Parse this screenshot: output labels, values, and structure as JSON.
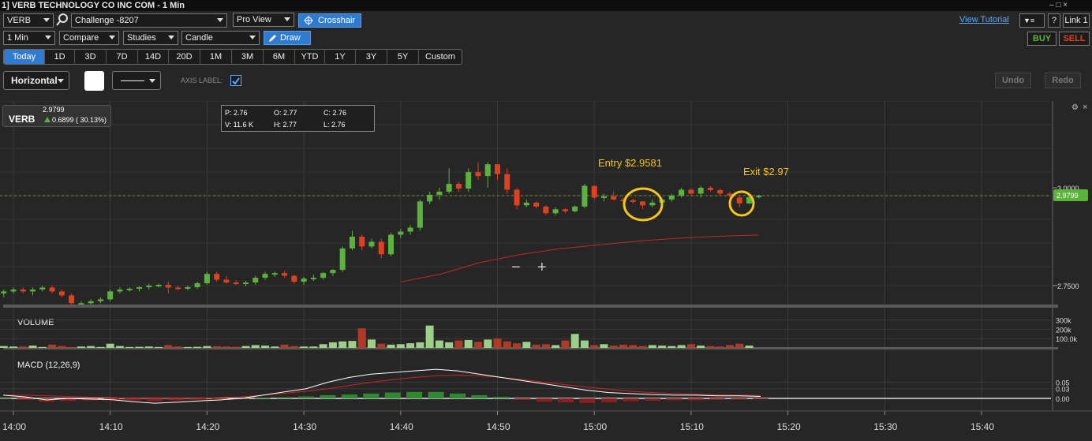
{
  "titlebar": {
    "title": "1] VERB TECHNOLOGY CO INC COM - 1 Min",
    "controls": "– □ ×"
  },
  "toolbar1": {
    "symbol": "VERB",
    "account": "Challenge -8207",
    "view": "Pro View",
    "crosshair_label": "Crosshair",
    "view_tutorial": "View Tutorial",
    "help": "?",
    "link": "Link 1"
  },
  "toolbar2": {
    "interval": "1 Min",
    "compare": "Compare",
    "studies": "Studies",
    "chart_type": "Candle",
    "draw_label": "Draw",
    "buy_label": "BUY",
    "sell_label": "SELL"
  },
  "ranges": [
    "Today",
    "1D",
    "3D",
    "7D",
    "14D",
    "20D",
    "1M",
    "3M",
    "6M",
    "YTD",
    "1Y",
    "3Y",
    "5Y",
    "Custom"
  ],
  "active_range": "Today",
  "drawbar": {
    "style": "Horizontal",
    "axis_label": "AXIS LABEL:",
    "undo": "Undo",
    "redo": "Redo"
  },
  "quote": {
    "symbol": "VERB",
    "last": "2.9799",
    "change": "0.6899 ( 30.13%)"
  },
  "ohlc": {
    "p": "P: 2.76",
    "o": "O: 2.77",
    "c": "C: 2.76",
    "v": "V: 11.6 K",
    "h": "H: 2.77",
    "l": "L: 2.76"
  },
  "zoom": {
    "minus": "−",
    "plus": "+"
  },
  "colors": {
    "up": "#5ab43c",
    "down": "#e0401e",
    "accent": "#2f7bd1",
    "annotation": "#f5c518",
    "background": "#262626"
  },
  "chart_data": {
    "type": "candlestick",
    "price_axis_labels": [
      "3.0000",
      "2.7500"
    ],
    "last_price_label": "2.9799",
    "volume_panel": {
      "title": "VOLUME",
      "axis_labels": [
        "300k",
        "200k",
        "100.0k"
      ]
    },
    "macd_panel": {
      "title": "MACD (12,26,9)",
      "axis_labels": [
        "0.05",
        "0.03",
        "0.00"
      ]
    },
    "time_labels": [
      "14:00",
      "14:10",
      "14:20",
      "14:30",
      "14:40",
      "14:50",
      "15:00",
      "15:10",
      "15:20",
      "15:30",
      "15:40"
    ],
    "annotations": [
      {
        "text": "Entry $2.9581",
        "time": "15:00"
      },
      {
        "text": "Exit $2.97",
        "time": "15:15"
      }
    ],
    "candles": [
      [
        "13:59",
        2.73,
        2.74,
        2.72,
        2.735
      ],
      [
        "14:00",
        2.735,
        2.745,
        2.73,
        2.74
      ],
      [
        "14:01",
        2.74,
        2.745,
        2.73,
        2.735
      ],
      [
        "14:02",
        2.735,
        2.745,
        2.725,
        2.74
      ],
      [
        "14:03",
        2.74,
        2.75,
        2.735,
        2.745
      ],
      [
        "14:04",
        2.745,
        2.75,
        2.73,
        2.735
      ],
      [
        "14:05",
        2.735,
        2.74,
        2.72,
        2.725
      ],
      [
        "14:06",
        2.725,
        2.73,
        2.7,
        2.705
      ],
      [
        "14:07",
        2.705,
        2.71,
        2.7,
        2.705
      ],
      [
        "14:08",
        2.705,
        2.715,
        2.7,
        2.71
      ],
      [
        "14:09",
        2.71,
        2.72,
        2.705,
        2.715
      ],
      [
        "14:10",
        2.715,
        2.74,
        2.71,
        2.735
      ],
      [
        "14:11",
        2.735,
        2.745,
        2.73,
        2.74
      ],
      [
        "14:12",
        2.74,
        2.745,
        2.735,
        2.742
      ],
      [
        "14:13",
        2.742,
        2.748,
        2.735,
        2.746
      ],
      [
        "14:14",
        2.746,
        2.755,
        2.74,
        2.75
      ],
      [
        "14:15",
        2.75,
        2.755,
        2.745,
        2.752
      ],
      [
        "14:16",
        2.752,
        2.76,
        2.73,
        2.745
      ],
      [
        "14:17",
        2.745,
        2.75,
        2.738,
        2.742
      ],
      [
        "14:18",
        2.742,
        2.75,
        2.738,
        2.746
      ],
      [
        "14:19",
        2.746,
        2.76,
        2.742,
        2.756
      ],
      [
        "14:20",
        2.756,
        2.785,
        2.752,
        2.78
      ],
      [
        "14:21",
        2.78,
        2.785,
        2.76,
        2.765
      ],
      [
        "14:22",
        2.765,
        2.775,
        2.755,
        2.758
      ],
      [
        "14:23",
        2.758,
        2.764,
        2.752,
        2.755
      ],
      [
        "14:24",
        2.755,
        2.762,
        2.748,
        2.758
      ],
      [
        "14:25",
        2.758,
        2.775,
        2.752,
        2.77
      ],
      [
        "14:26",
        2.77,
        2.785,
        2.765,
        2.78
      ],
      [
        "14:27",
        2.78,
        2.786,
        2.772,
        2.782
      ],
      [
        "14:28",
        2.782,
        2.787,
        2.77,
        2.775
      ],
      [
        "14:29",
        2.775,
        2.778,
        2.755,
        2.76
      ],
      [
        "14:30",
        2.76,
        2.772,
        2.752,
        2.768
      ],
      [
        "14:31",
        2.768,
        2.778,
        2.762,
        2.77
      ],
      [
        "14:32",
        2.77,
        2.785,
        2.765,
        2.782
      ],
      [
        "14:33",
        2.782,
        2.792,
        2.775,
        2.79
      ],
      [
        "14:34",
        2.79,
        2.85,
        2.785,
        2.845
      ],
      [
        "14:35",
        2.845,
        2.89,
        2.84,
        2.875
      ],
      [
        "14:36",
        2.875,
        2.88,
        2.84,
        2.85
      ],
      [
        "14:37",
        2.85,
        2.87,
        2.845,
        2.862
      ],
      [
        "14:38",
        2.862,
        2.87,
        2.82,
        2.83
      ],
      [
        "14:39",
        2.83,
        2.885,
        2.825,
        2.88
      ],
      [
        "14:40",
        2.88,
        2.895,
        2.872,
        2.888
      ],
      [
        "14:41",
        2.888,
        2.905,
        2.88,
        2.898
      ],
      [
        "14:42",
        2.898,
        2.97,
        2.89,
        2.965
      ],
      [
        "14:43",
        2.965,
        2.99,
        2.958,
        2.982
      ],
      [
        "14:44",
        2.982,
        3.0,
        2.97,
        2.99
      ],
      [
        "14:45",
        2.99,
        3.05,
        2.985,
        3.01
      ],
      [
        "14:46",
        3.01,
        3.015,
        2.99,
        2.998
      ],
      [
        "14:47",
        2.998,
        3.05,
        2.99,
        3.04
      ],
      [
        "14:48",
        3.04,
        3.065,
        3.02,
        3.03
      ],
      [
        "14:49",
        3.03,
        3.065,
        3.0,
        3.06
      ],
      [
        "14:50",
        3.06,
        3.06,
        3.02,
        3.035
      ],
      [
        "14:51",
        3.035,
        3.05,
        2.985,
        2.995
      ],
      [
        "14:52",
        2.995,
        3.0,
        2.945,
        2.955
      ],
      [
        "14:53",
        2.955,
        2.97,
        2.95,
        2.962
      ],
      [
        "14:54",
        2.962,
        2.965,
        2.948,
        2.952
      ],
      [
        "14:55",
        2.952,
        2.955,
        2.93,
        2.935
      ],
      [
        "14:56",
        2.935,
        2.95,
        2.93,
        2.945
      ],
      [
        "14:57",
        2.945,
        2.948,
        2.935,
        2.94
      ],
      [
        "14:58",
        2.94,
        2.955,
        2.937,
        2.952
      ],
      [
        "14:59",
        2.952,
        3.01,
        2.948,
        3.005
      ],
      [
        "15:00",
        3.005,
        3.0,
        2.97,
        2.975
      ],
      [
        "15:01",
        2.975,
        2.985,
        2.965,
        2.978
      ],
      [
        "15:02",
        2.978,
        2.99,
        2.968,
        2.97
      ],
      [
        "15:03",
        2.97,
        2.975,
        2.962,
        2.968
      ],
      [
        "15:04",
        2.968,
        2.972,
        2.96,
        2.965
      ],
      [
        "15:05",
        2.965,
        2.966,
        2.945,
        2.955
      ],
      [
        "15:06",
        2.955,
        2.97,
        2.95,
        2.962
      ],
      [
        "15:07",
        2.962,
        2.975,
        2.955,
        2.97
      ],
      [
        "15:08",
        2.97,
        2.985,
        2.965,
        2.98
      ],
      [
        "15:09",
        2.98,
        3.0,
        2.975,
        2.995
      ],
      [
        "15:10",
        2.995,
        2.998,
        2.98,
        2.985
      ],
      [
        "15:11",
        2.985,
        3.005,
        2.975,
        3.0
      ],
      [
        "15:12",
        3.0,
        3.004,
        2.99,
        2.994
      ],
      [
        "15:13",
        2.994,
        2.998,
        2.98,
        2.985
      ],
      [
        "15:14",
        2.985,
        2.99,
        2.975,
        2.98
      ],
      [
        "15:15",
        2.975,
        2.978,
        2.95,
        2.96
      ],
      [
        "15:16",
        2.96,
        2.98,
        2.958,
        2.976
      ],
      [
        "15:17",
        2.976,
        2.982,
        2.972,
        2.98
      ]
    ],
    "ma_values": [
      2.85,
      2.87,
      2.9,
      2.92,
      2.935,
      2.945,
      2.955,
      2.962,
      2.967,
      2.97
    ],
    "volume": [
      20,
      15,
      15,
      25,
      10,
      35,
      20,
      10,
      15,
      20,
      10,
      45,
      20,
      10,
      12,
      15,
      10,
      30,
      15,
      10,
      12,
      20,
      18,
      15,
      12,
      20,
      30,
      25,
      15,
      35,
      20,
      15,
      15,
      40,
      60,
      70,
      75,
      210,
      90,
      45,
      35,
      40,
      50,
      60,
      240,
      80,
      60,
      80,
      85,
      65,
      90,
      100,
      70,
      50,
      65,
      35,
      40,
      30,
      80,
      150,
      80,
      30,
      40,
      25,
      35,
      30,
      20,
      30,
      25,
      20,
      30,
      40,
      25,
      20,
      15,
      30,
      45,
      25
    ],
    "macd": [
      0.01,
      0.005,
      -0.005,
      0.0,
      -0.002,
      -0.004,
      -0.01,
      -0.015,
      -0.012,
      -0.008,
      -0.005,
      0.0,
      0.01,
      0.02,
      0.03,
      0.05,
      0.065,
      0.075,
      0.08,
      0.085,
      0.09,
      0.085,
      0.075,
      0.065,
      0.055,
      0.045,
      0.035,
      0.025,
      0.018,
      0.015,
      0.012,
      0.01,
      0.01,
      0.008,
      0.008,
      0.006
    ],
    "macd_signal": [
      0.01,
      0.01,
      0.008,
      0.006,
      0.004,
      0.002,
      0.0,
      0.0,
      0.0,
      0.0,
      0.002,
      0.005,
      0.01,
      0.016,
      0.022,
      0.03,
      0.04,
      0.05,
      0.058,
      0.065,
      0.07,
      0.072,
      0.07,
      0.065,
      0.058,
      0.05,
      0.042,
      0.035,
      0.028,
      0.022,
      0.018,
      0.015,
      0.013,
      0.011,
      0.01,
      0.009
    ],
    "macd_hist": [
      0.0,
      -0.005,
      -0.01,
      -0.008,
      -0.006,
      -0.006,
      -0.006,
      -0.008,
      -0.006,
      -0.004,
      -0.002,
      0.0,
      0.002,
      0.004,
      0.006,
      0.01,
      0.012,
      0.015,
      0.018,
      0.02,
      0.02,
      0.015,
      0.01,
      0.005,
      -0.005,
      -0.01,
      -0.012,
      -0.014,
      -0.012,
      -0.009,
      -0.007,
      -0.006,
      -0.006,
      -0.005,
      -0.004,
      -0.003
    ]
  }
}
